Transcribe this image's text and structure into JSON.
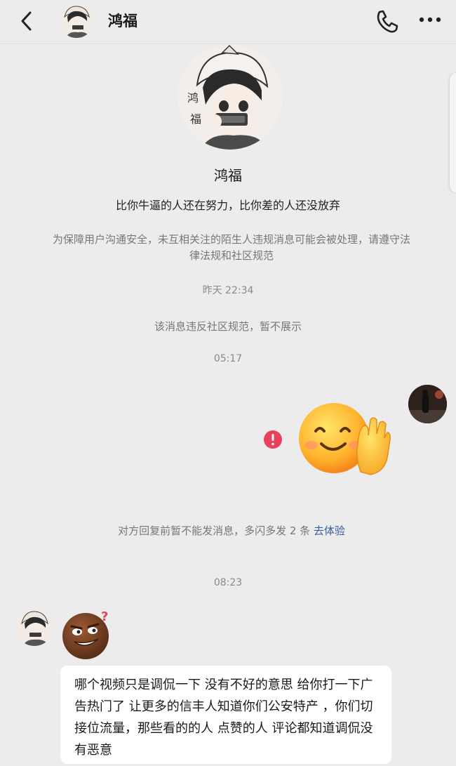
{
  "header": {
    "title": "鸿福",
    "icons": {
      "back": "chevron-left-icon",
      "call": "phone-icon",
      "more": "more-dots-icon"
    }
  },
  "profile": {
    "name": "鸿福",
    "bio": "比你牛逼的人还在努力，比你差的人还没放弃",
    "avatar_text": [
      "鸿",
      "福"
    ]
  },
  "notice": "为保障用户沟通安全，未互相关注的陌生人违规消息可能会被处理，请遵守法律法规和社区规范",
  "messages": {
    "time1": "昨天 22:34",
    "hidden_message": "该消息违反社区规范，暂不展示",
    "time2": "05:17",
    "limit_notice": "对方回复前暂不能发消息，多闪多发 2 条 ",
    "limit_link": "去体验",
    "time3": "08:23",
    "reply_text": "哪个视频只是调侃一下  没有不好的意思  给你打一下广告热门了  让更多的信丰人知道你们公安特产  ，你们切接位流量，那些看的的人 点赞的人  评论都知道调侃没有恶意"
  },
  "colors": {
    "background": "#ececec",
    "error_red": "#e8415a",
    "link_blue": "#3b5e9c",
    "bubble": "#ffffff"
  }
}
